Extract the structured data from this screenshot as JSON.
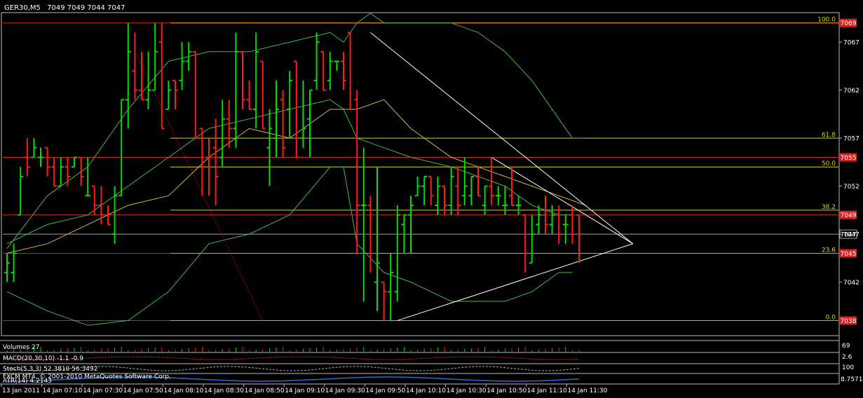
{
  "header": {
    "symbol": "GER30,M5",
    "ohlc": "7049 7049 7044 7047"
  },
  "chart_data": {
    "type": "bar",
    "subtype": "ohlc",
    "colors": {
      "background": "#000000",
      "bull": "#00dd00",
      "bear": "#ff1a1a",
      "bands": "#48b848",
      "ma": "#d4b84a",
      "fib": "#d8d800",
      "level_lines": "#d82020",
      "orange_lines": "#ff9a00",
      "trendlines": "#ffffff",
      "current_price": "#a0a0a0",
      "text": "#ffffff"
    },
    "y_axis": {
      "min": 7036.5,
      "max": 7070,
      "ticks": [
        "7067",
        "7062",
        "7057",
        "7052",
        "7047",
        "7042"
      ],
      "tick_values": [
        7067,
        7062,
        7057,
        7052,
        7047,
        7042
      ],
      "current_price_label": "7047",
      "current_price": 7047
    },
    "x_axis": {
      "labels": [
        "13 Jan 2011",
        "14 Jan 07:10",
        "14 Jan 07:30",
        "14 Jan 07:50",
        "14 Jan 08:10",
        "14 Jan 08:30",
        "14 Jan 08:50",
        "14 Jan 09:10",
        "14 Jan 09:30",
        "14 Jan 09:50",
        "14 Jan 10:10",
        "14 Jan 10:30",
        "14 Jan 10:50",
        "14 Jan 11:10",
        "14 Jan 11:30"
      ],
      "label_bar_index": [
        0,
        6,
        12,
        18,
        24,
        30,
        36,
        42,
        48,
        54,
        60,
        66,
        72,
        78,
        84
      ]
    },
    "bars": [
      {
        "o": 7043,
        "h": 7045,
        "l": 7042,
        "c": 7044
      },
      {
        "o": 7043,
        "h": 7046,
        "l": 7042,
        "c": 7045
      },
      {
        "o": 7049,
        "h": 7054,
        "l": 7049,
        "c": 7053
      },
      {
        "o": 7055,
        "h": 7057,
        "l": 7053,
        "c": 7054
      },
      {
        "o": 7055,
        "h": 7057,
        "l": 7055,
        "c": 7056
      },
      {
        "o": 7055,
        "h": 7056,
        "l": 7054,
        "c": 7055
      },
      {
        "o": 7056,
        "h": 7056,
        "l": 7053,
        "c": 7054
      },
      {
        "o": 7054,
        "h": 7055,
        "l": 7052,
        "c": 7052
      },
      {
        "o": 7052,
        "h": 7055,
        "l": 7052,
        "c": 7054
      },
      {
        "o": 7054,
        "h": 7055,
        "l": 7052,
        "c": 7053
      },
      {
        "o": 7054,
        "h": 7055,
        "l": 7054,
        "c": 7055
      },
      {
        "o": 7055,
        "h": 7055,
        "l": 7052,
        "c": 7053
      },
      {
        "o": 7051,
        "h": 7055,
        "l": 7051,
        "c": 7051
      },
      {
        "o": 7052,
        "h": 7052,
        "l": 7049,
        "c": 7050
      },
      {
        "o": 7050,
        "h": 7052,
        "l": 7048,
        "c": 7049
      },
      {
        "o": 7049,
        "h": 7050,
        "l": 7048,
        "c": 7048
      },
      {
        "o": 7047,
        "h": 7052,
        "l": 7046,
        "c": 7051
      },
      {
        "o": 7051,
        "h": 7061,
        "l": 7051,
        "c": 7061
      },
      {
        "o": 7061,
        "h": 7069,
        "l": 7058,
        "c": 7066
      },
      {
        "o": 7064,
        "h": 7068,
        "l": 7061,
        "c": 7062
      },
      {
        "o": 7062,
        "h": 7066,
        "l": 7061,
        "c": 7061
      },
      {
        "o": 7061,
        "h": 7066,
        "l": 7060,
        "c": 7062
      },
      {
        "o": 7062,
        "h": 7069,
        "l": 7062,
        "c": 7066
      },
      {
        "o": 7067,
        "h": 7069,
        "l": 7058,
        "c": 7058
      },
      {
        "o": 7060,
        "h": 7063,
        "l": 7060,
        "c": 7062
      },
      {
        "o": 7063,
        "h": 7063,
        "l": 7060,
        "c": 7062
      },
      {
        "o": 7063,
        "h": 7067,
        "l": 7062,
        "c": 7065
      },
      {
        "o": 7065,
        "h": 7067,
        "l": 7064,
        "c": 7066
      },
      {
        "o": 7066,
        "h": 7066,
        "l": 7057,
        "c": 7057
      },
      {
        "o": 7058,
        "h": 7058,
        "l": 7051,
        "c": 7054
      },
      {
        "o": 7055,
        "h": 7057,
        "l": 7051,
        "c": 7054
      },
      {
        "o": 7056,
        "h": 7059,
        "l": 7050,
        "c": 7053
      },
      {
        "o": 7055,
        "h": 7061,
        "l": 7054,
        "c": 7059
      },
      {
        "o": 7059,
        "h": 7061,
        "l": 7056,
        "c": 7058
      },
      {
        "o": 7058,
        "h": 7068,
        "l": 7056,
        "c": 7066
      },
      {
        "o": 7066,
        "h": 7066,
        "l": 7060,
        "c": 7061
      },
      {
        "o": 7061,
        "h": 7063,
        "l": 7060,
        "c": 7060
      },
      {
        "o": 7060,
        "h": 7068,
        "l": 7058,
        "c": 7066
      },
      {
        "o": 7065,
        "h": 7065,
        "l": 7058,
        "c": 7058
      },
      {
        "o": 7056,
        "h": 7060,
        "l": 7052,
        "c": 7058
      },
      {
        "o": 7057,
        "h": 7063,
        "l": 7055,
        "c": 7060
      },
      {
        "o": 7061,
        "h": 7062,
        "l": 7055,
        "c": 7056
      },
      {
        "o": 7060,
        "h": 7064,
        "l": 7057,
        "c": 7063
      },
      {
        "o": 7065,
        "h": 7065,
        "l": 7055,
        "c": 7055
      },
      {
        "o": 7057,
        "h": 7063,
        "l": 7056,
        "c": 7058
      },
      {
        "o": 7059,
        "h": 7062,
        "l": 7055,
        "c": 7062
      },
      {
        "o": 7063,
        "h": 7068,
        "l": 7062,
        "c": 7067
      },
      {
        "o": 7066,
        "h": 7066,
        "l": 7062,
        "c": 7062
      },
      {
        "o": 7063,
        "h": 7066,
        "l": 7062,
        "c": 7065
      },
      {
        "o": 7065,
        "h": 7064,
        "l": 7064,
        "c": 7065
      },
      {
        "o": 7065,
        "h": 7066,
        "l": 7062,
        "c": 7063
      },
      {
        "o": 7068,
        "h": 7068,
        "l": 7060,
        "c": 7060
      },
      {
        "o": 7061,
        "h": 7062,
        "l": 7045,
        "c": 7050
      },
      {
        "o": 7050,
        "h": 7056,
        "l": 7040,
        "c": 7050
      },
      {
        "o": 7050,
        "h": 7051,
        "l": 7043,
        "c": 7045
      },
      {
        "o": 7042,
        "h": 7054,
        "l": 7039,
        "c": 7044
      },
      {
        "o": 7042,
        "h": 7042,
        "l": 7038,
        "c": 7041
      },
      {
        "o": 7041,
        "h": 7045,
        "l": 7038,
        "c": 7043
      },
      {
        "o": 7041,
        "h": 7050,
        "l": 7040,
        "c": 7049
      },
      {
        "o": 7048,
        "h": 7049,
        "l": 7045,
        "c": 7049
      },
      {
        "o": 7049,
        "h": 7051,
        "l": 7045,
        "c": 7050
      },
      {
        "o": 7051,
        "h": 7053,
        "l": 7051,
        "c": 7052
      },
      {
        "o": 7052,
        "h": 7053,
        "l": 7050,
        "c": 7053
      },
      {
        "o": 7053,
        "h": 7053,
        "l": 7050,
        "c": 7051
      },
      {
        "o": 7050,
        "h": 7053,
        "l": 7049,
        "c": 7052
      },
      {
        "o": 7052,
        "h": 7052,
        "l": 7049,
        "c": 7050
      },
      {
        "o": 7050,
        "h": 7054,
        "l": 7049,
        "c": 7053
      },
      {
        "o": 7052,
        "h": 7054,
        "l": 7049,
        "c": 7050
      },
      {
        "o": 7051,
        "h": 7055,
        "l": 7050,
        "c": 7052
      },
      {
        "o": 7051,
        "h": 7053,
        "l": 7050,
        "c": 7053
      },
      {
        "o": 7053,
        "h": 7054,
        "l": 7051,
        "c": 7051
      },
      {
        "o": 7050,
        "h": 7052,
        "l": 7049,
        "c": 7052
      },
      {
        "o": 7052,
        "h": 7055,
        "l": 7050,
        "c": 7051
      },
      {
        "o": 7051,
        "h": 7052,
        "l": 7050,
        "c": 7051
      },
      {
        "o": 7050,
        "h": 7052,
        "l": 7049,
        "c": 7050
      },
      {
        "o": 7051,
        "h": 7054,
        "l": 7050,
        "c": 7050
      },
      {
        "o": 7050,
        "h": 7051,
        "l": 7049,
        "c": 7050
      },
      {
        "o": 7049,
        "h": 7049,
        "l": 7043,
        "c": 7045
      },
      {
        "o": 7044,
        "h": 7049,
        "l": 7045,
        "c": 7047
      },
      {
        "o": 7048,
        "h": 7050,
        "l": 7047,
        "c": 7049
      },
      {
        "o": 7049,
        "h": 7051,
        "l": 7047,
        "c": 7048
      },
      {
        "o": 7048,
        "h": 7050,
        "l": 7047,
        "c": 7049
      },
      {
        "o": 7049,
        "h": 7050,
        "l": 7046,
        "c": 7047
      },
      {
        "o": 7048,
        "h": 7049,
        "l": 7046,
        "c": 7048
      },
      {
        "o": 7049,
        "h": 7050,
        "l": 7046,
        "c": 7047
      },
      {
        "o": 7049,
        "h": 7049,
        "l": 7044,
        "c": 7047
      }
    ],
    "bollinger_upper": [
      [
        0,
        7045.5
      ],
      [
        6,
        7051
      ],
      [
        12,
        7054
      ],
      [
        18,
        7060
      ],
      [
        24,
        7065
      ],
      [
        30,
        7066
      ],
      [
        36,
        7066
      ],
      [
        42,
        7067
      ],
      [
        48,
        7068
      ],
      [
        50,
        7067
      ],
      [
        52,
        7069
      ],
      [
        54,
        7070
      ],
      [
        56,
        7069
      ],
      [
        60,
        7069
      ],
      [
        66,
        7069
      ],
      [
        70,
        7068
      ],
      [
        74,
        7066
      ],
      [
        78,
        7063
      ],
      [
        82,
        7059
      ],
      [
        84,
        7057
      ],
      [
        86,
        7057
      ]
    ],
    "bollinger_middle": [
      [
        0,
        7046
      ],
      [
        6,
        7048
      ],
      [
        12,
        7049
      ],
      [
        18,
        7052
      ],
      [
        24,
        7055
      ],
      [
        30,
        7058
      ],
      [
        36,
        7059
      ],
      [
        42,
        7060
      ],
      [
        48,
        7061
      ],
      [
        50,
        7060
      ],
      [
        52,
        7057
      ],
      [
        56,
        7056
      ],
      [
        60,
        7055
      ],
      [
        66,
        7054
      ],
      [
        70,
        7053
      ],
      [
        74,
        7052
      ],
      [
        78,
        7050
      ],
      [
        82,
        7049
      ],
      [
        84,
        7049
      ]
    ],
    "bollinger_lower": [
      [
        0,
        7041
      ],
      [
        6,
        7039
      ],
      [
        12,
        7037.5
      ],
      [
        18,
        7038
      ],
      [
        24,
        7041
      ],
      [
        30,
        7046
      ],
      [
        36,
        7047
      ],
      [
        42,
        7049
      ],
      [
        48,
        7054
      ],
      [
        50,
        7054
      ],
      [
        52,
        7046
      ],
      [
        56,
        7043
      ],
      [
        60,
        7042
      ],
      [
        66,
        7040
      ],
      [
        70,
        7040
      ],
      [
        74,
        7040
      ],
      [
        78,
        7041
      ],
      [
        82,
        7043
      ],
      [
        84,
        7043
      ]
    ],
    "moving_average": [
      [
        0,
        7045
      ],
      [
        6,
        7046
      ],
      [
        12,
        7048
      ],
      [
        18,
        7050
      ],
      [
        24,
        7051
      ],
      [
        30,
        7055
      ],
      [
        36,
        7058
      ],
      [
        42,
        7057
      ],
      [
        48,
        7060
      ],
      [
        52,
        7060
      ],
      [
        56,
        7061
      ],
      [
        60,
        7058
      ],
      [
        66,
        7055
      ],
      [
        70,
        7054
      ],
      [
        74,
        7053
      ],
      [
        78,
        7052
      ],
      [
        82,
        7051
      ],
      [
        86,
        7050
      ]
    ],
    "fib_levels": [
      {
        "label": "100.0",
        "value": 7069
      },
      {
        "label": "61.8",
        "value": 7057
      },
      {
        "label": "50.0",
        "value": 7054
      },
      {
        "label": "38.2",
        "value": 7049.5
      },
      {
        "label": "23.6",
        "value": 7045
      },
      {
        "label": "0.0",
        "value": 7038
      }
    ],
    "price_levels": [
      {
        "label": "7069",
        "value": 7069
      },
      {
        "label": "7055",
        "value": 7055
      },
      {
        "label": "7049",
        "value": 7049
      },
      {
        "label": "7045",
        "value": 7045
      },
      {
        "label": "7038",
        "value": 7038
      }
    ],
    "trendlines": [
      {
        "from": [
          54,
          7068
        ],
        "to": [
          93,
          7046
        ]
      },
      {
        "from": [
          72,
          7055
        ],
        "to": [
          93,
          7046
        ]
      },
      {
        "from": [
          58,
          7038
        ],
        "to": [
          93,
          7046
        ]
      }
    ],
    "red_dotted_line": {
      "from": [
        19,
        7066
      ],
      "to": [
        38,
        7038
      ]
    }
  },
  "indicators": {
    "volumes": {
      "label": "Volumes 27",
      "scale_label": "69"
    },
    "macd": {
      "label": "MACD(20,30,10) -1.1 -0.9",
      "scale_label": "2.6"
    },
    "stoch": {
      "label": "Stoch(5,3,3) 52.3810 56.3492",
      "scale_label": "100"
    },
    "atr": {
      "label": "ATR(14) 4.2143",
      "scale_label": "8.7571"
    }
  },
  "footer": {
    "copyright": "FXCM MT4, © 2001-2010 MetaQuotes Software Corp."
  }
}
